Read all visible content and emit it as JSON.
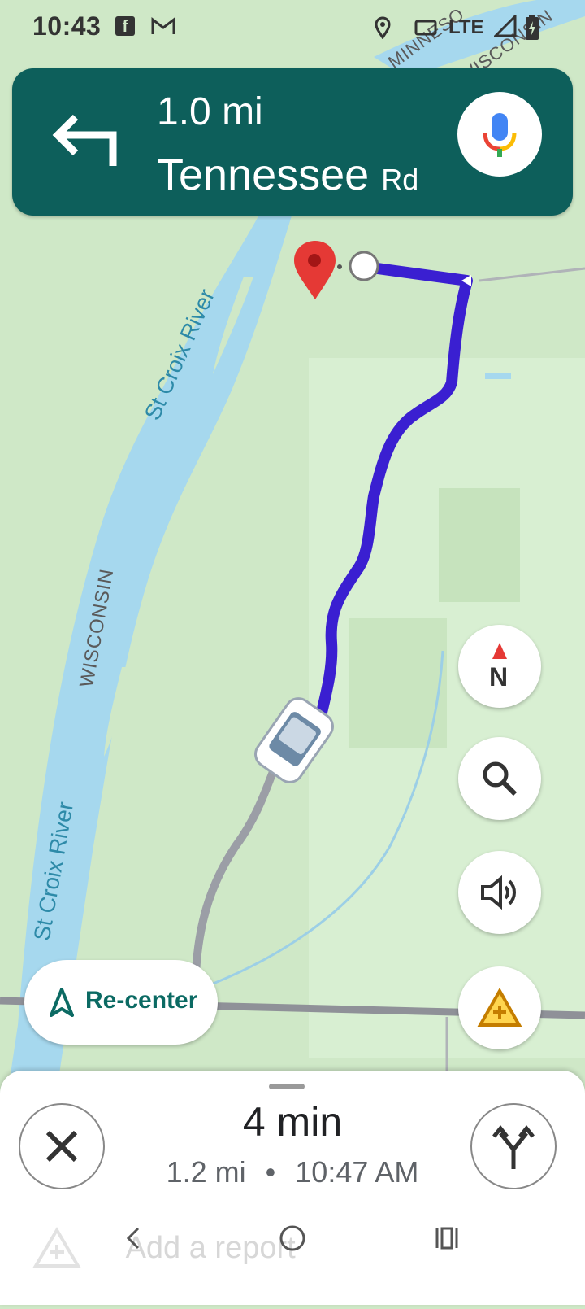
{
  "status_bar": {
    "time": "10:43",
    "icons": [
      "facebook-icon",
      "gmail-icon",
      "location-icon",
      "cast-icon",
      "signal-icon",
      "battery-charging-icon"
    ],
    "network": "LTE"
  },
  "navigation": {
    "maneuver": "turn-left",
    "distance": "1.0 mi",
    "street_main": "Tennessee",
    "street_suffix": "Rd"
  },
  "map": {
    "labels": {
      "river_top": "St Croix River",
      "state_mid": "WISCONSIN",
      "river_bottom": "St Croix River",
      "top_right_1": "MINNESO",
      "top_right_2": "WISCONSIN"
    },
    "colors": {
      "route": "#3a1fd1",
      "water": "#a6d8ee",
      "land": "#cfe8c7",
      "road": "#9b9ea6",
      "pin": "#e53935"
    }
  },
  "controls": {
    "compass_label": "N",
    "recenter_label": "Re-center"
  },
  "trip": {
    "duration": "4 min",
    "distance": "1.2 mi",
    "separator": "•",
    "arrival": "10:47 AM"
  },
  "faded": {
    "add_report": "Add a report"
  }
}
